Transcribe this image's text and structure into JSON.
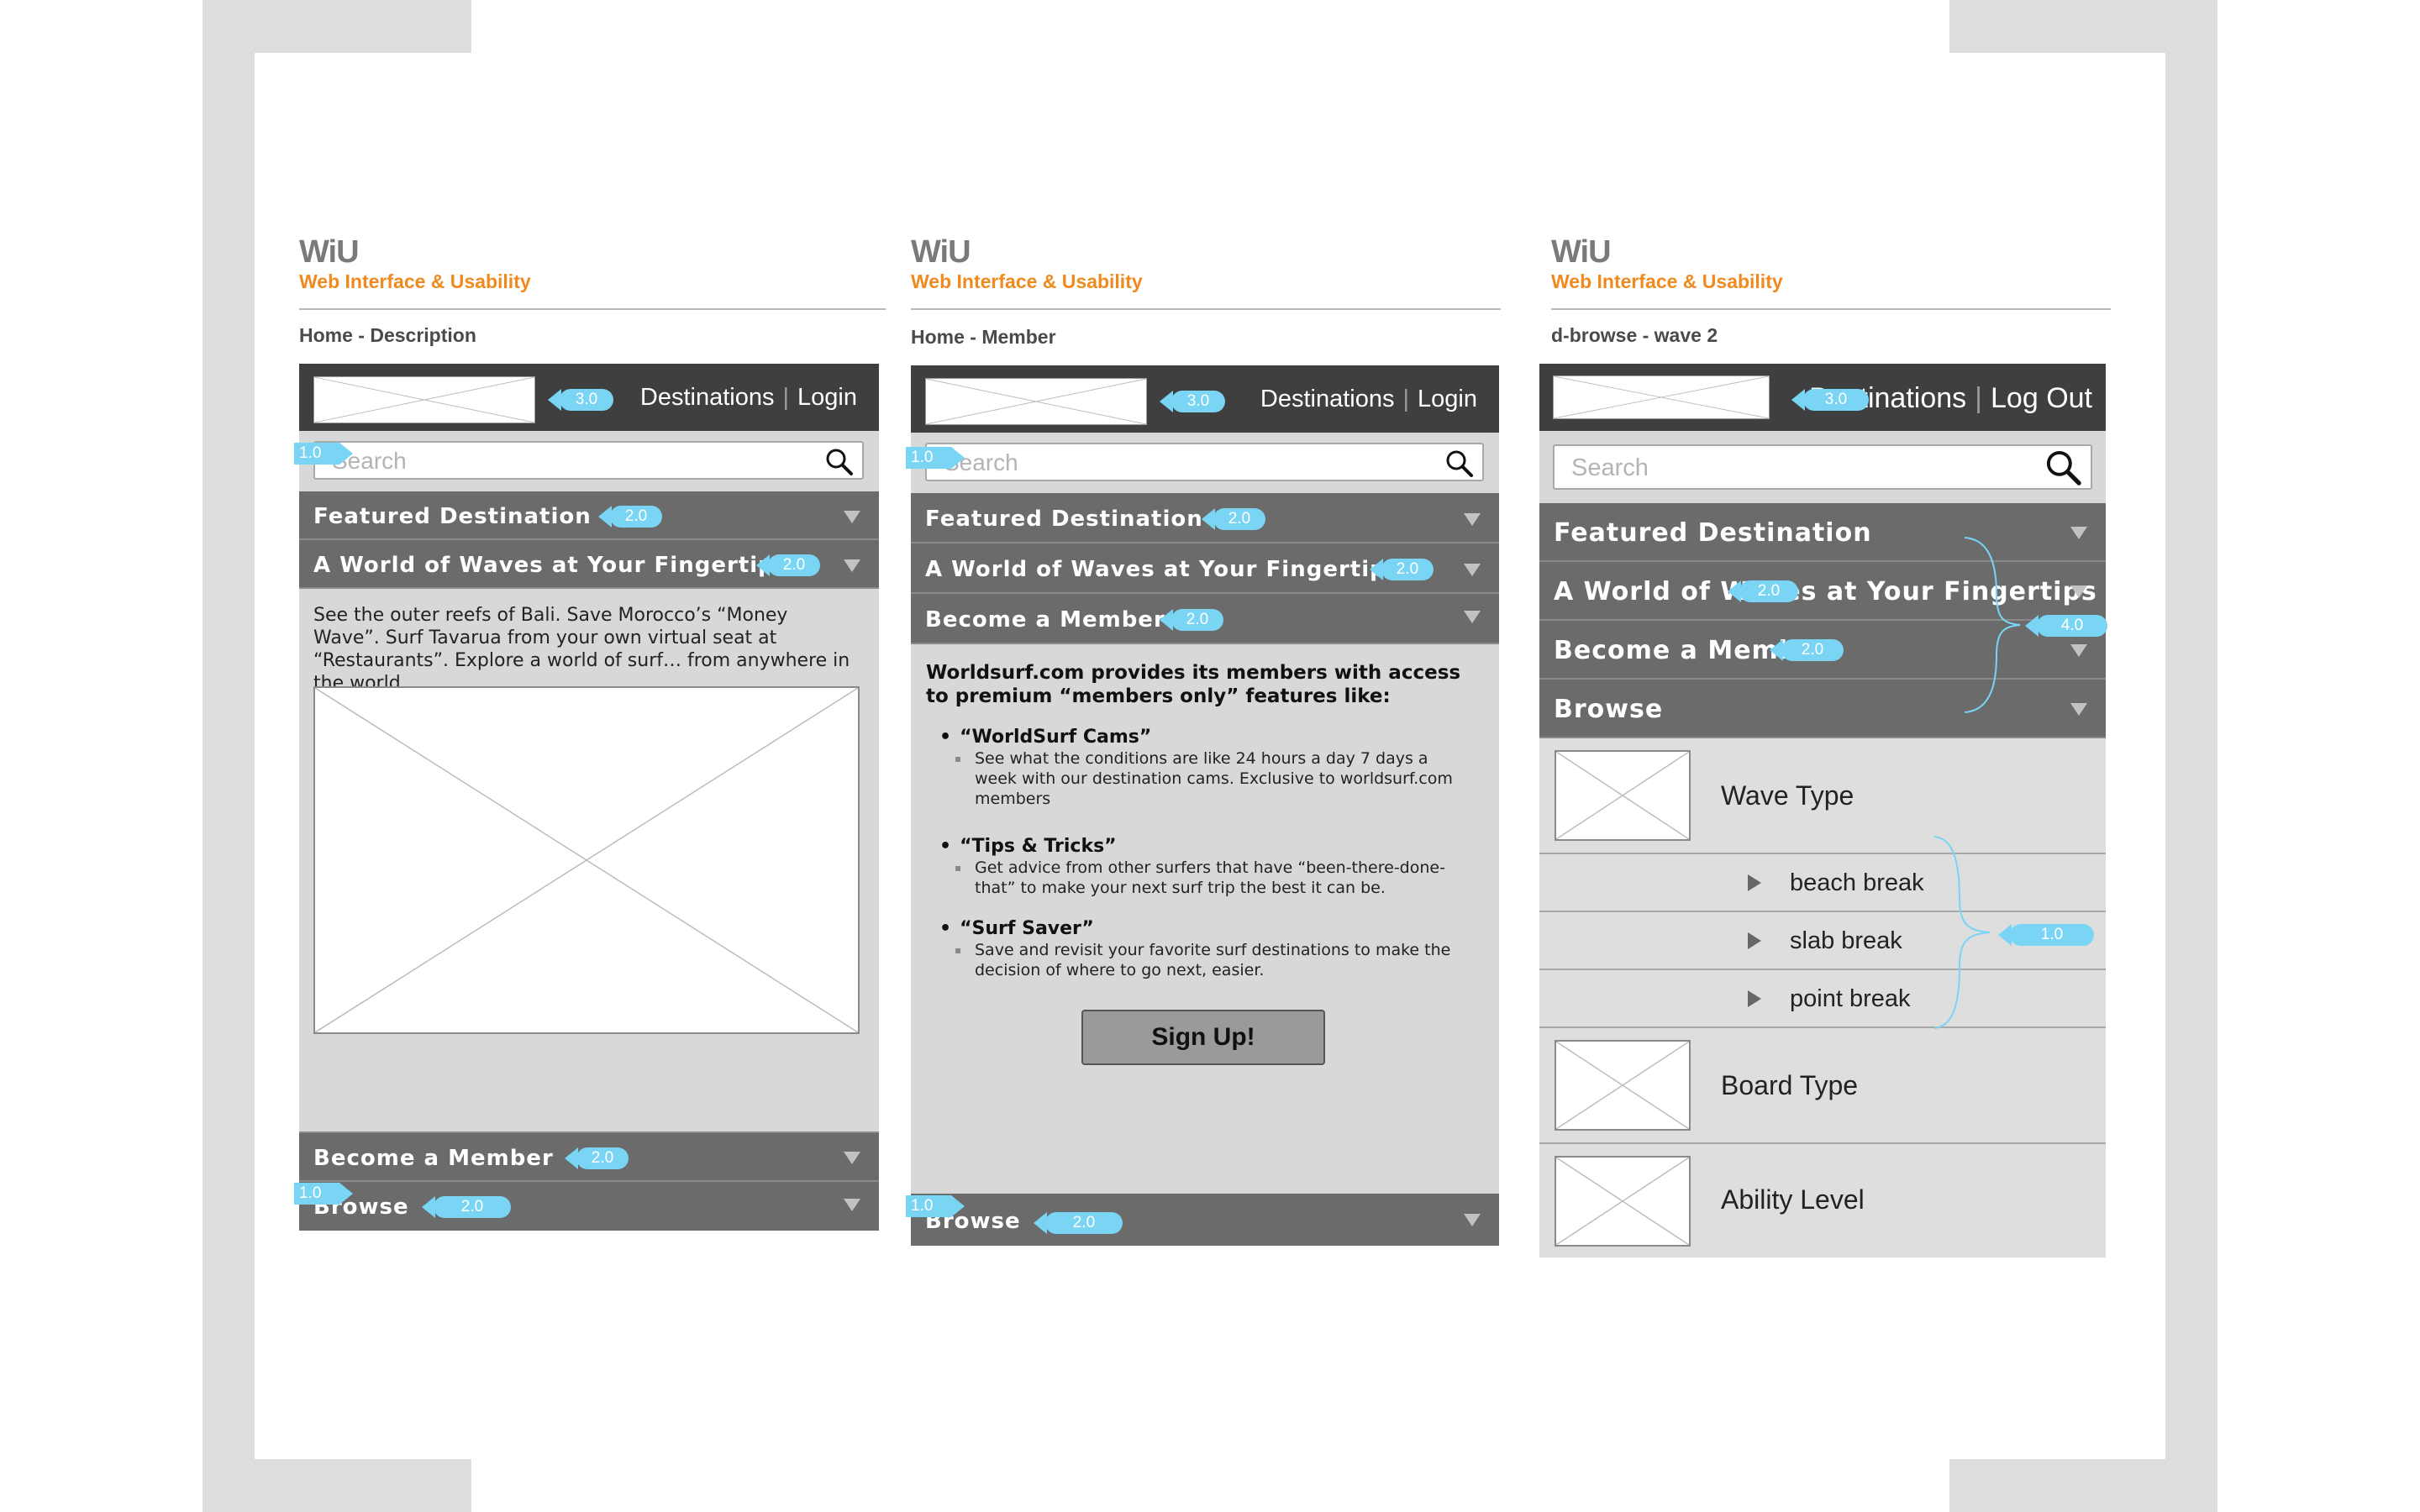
{
  "brand": {
    "title": "WiU",
    "subtitle": "Web Interface & Usability"
  },
  "colors": {
    "accent_orange": "#f08a1e",
    "annotation_blue": "#7ad4f4",
    "header_dark": "#3f3f3f",
    "accordion_gray": "#6b6b6b"
  },
  "panels": [
    {
      "page_label": "Home - Description",
      "nav": {
        "destinations": "Destinations",
        "separator": "|",
        "auth": "Login"
      },
      "search_placeholder": "Search",
      "sections": {
        "featured": "Featured Destination",
        "world": "A World of Waves at Your Fingertips",
        "member": "Become a Member",
        "browse": "Browse"
      },
      "description": "See the outer reefs of Bali. Save Morocco’s “Money Wave”. Surf Tavarua from your own virtual seat at “Restaurants”. Explore a world of surf… from anywhere in the world.",
      "annotations": {
        "logo": "3.0",
        "search": "1.0",
        "featured": "2.0",
        "world": "2.0",
        "member": "2.0",
        "browse_level": "1.0",
        "browse": "2.0"
      }
    },
    {
      "page_label": "Home - Member",
      "nav": {
        "destinations": "Destinations",
        "separator": "|",
        "auth": "Login"
      },
      "search_placeholder": "Search",
      "sections": {
        "featured": "Featured Destination",
        "world": "A World of Waves at Your Fingertips",
        "member": "Become a Member",
        "browse": "Browse"
      },
      "member_intro": "Worldsurf.com provides its members with access to premium “members only” features like:",
      "features": [
        {
          "title": "“WorldSurf Cams”",
          "desc": "See what the conditions are like 24 hours a day 7 days a week with our destination cams. Exclusive to worldsurf.com members"
        },
        {
          "title": "“Tips & Tricks”",
          "desc": "Get advice from other surfers that have “been-there-done-that” to make your next surf trip the best it can be."
        },
        {
          "title": "“Surf Saver”",
          "desc": "Save and revisit your favorite surf destinations to make the decision of where to go next, easier."
        }
      ],
      "signup_label": "Sign Up!",
      "annotations": {
        "logo": "3.0",
        "search": "1.0",
        "featured": "2.0",
        "world": "2.0",
        "member": "2.0",
        "browse_level": "1.0",
        "browse": "2.0"
      }
    },
    {
      "page_label": "d-browse - wave 2",
      "nav": {
        "destinations": "Destinations",
        "separator": "|",
        "auth": "Log Out"
      },
      "search_placeholder": "Search",
      "sections": {
        "featured": "Featured Destination",
        "world": "A World of Waves at Your Fingertips",
        "member": "Become a Member",
        "browse": "Browse"
      },
      "browse_items": {
        "wave_type": "Wave Type",
        "board_type": "Board Type",
        "ability_level": "Ability Level"
      },
      "wave_subtypes": [
        "beach break",
        "slab break",
        "point break"
      ],
      "annotations": {
        "logo": "3.0",
        "world": "2.0",
        "member": "2.0",
        "group": "4.0",
        "subtypes": "1.0"
      }
    }
  ]
}
